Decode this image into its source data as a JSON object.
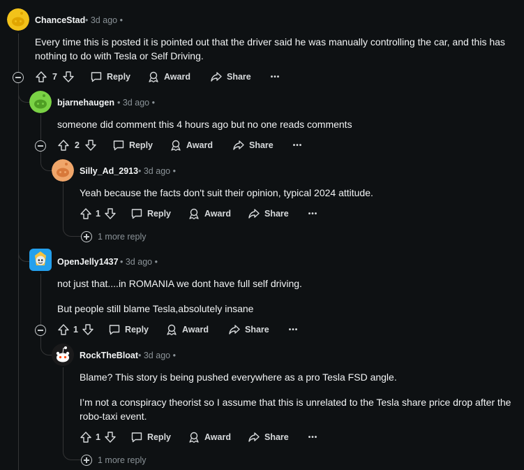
{
  "ui": {
    "reply_label": "Reply",
    "award_label": "Award",
    "share_label": "Share",
    "overflow_label": "•••"
  },
  "comments": [
    {
      "author": "ChanceStad",
      "time": "3d ago",
      "paragraphs": [
        "Every time this is posted it is pointed out that the driver said he was manually controlling the car, and this has nothing to do with Tesla or Self Driving."
      ],
      "votes": "7",
      "avatar_color": "#f2c21a"
    },
    {
      "author": "bjarnehaugen",
      "time": "3d ago",
      "paragraphs": [
        "someone did comment this 4 hours ago but no one reads comments"
      ],
      "votes": "2",
      "avatar_color": "#7ad245"
    },
    {
      "author": "Silly_Ad_2913",
      "time": "3d ago",
      "paragraphs": [
        "Yeah because the facts don't suit their opinion, typical 2024 attitude."
      ],
      "votes": "1",
      "more_replies": "1 more reply",
      "avatar_color": "#f0a66a"
    },
    {
      "author": "OpenJelly1437",
      "time": "3d ago",
      "paragraphs": [
        "not just that....in ROMANIA we dont have full self driving.",
        "But people still blame Tesla,absolutely insane"
      ],
      "votes": "1",
      "avatar_color": "#24a0ed"
    },
    {
      "author": "RockTheBloat",
      "time": "3d ago",
      "paragraphs": [
        "Blame? This story is being pushed everywhere as a pro Tesla FSD angle.",
        "I’m not a conspiracy theorist so I assume that this is unrelated to the Tesla share price drop after the robo-taxi event."
      ],
      "votes": "1",
      "more_replies": "1 more reply",
      "avatar_color": "#1a1a1b"
    }
  ]
}
